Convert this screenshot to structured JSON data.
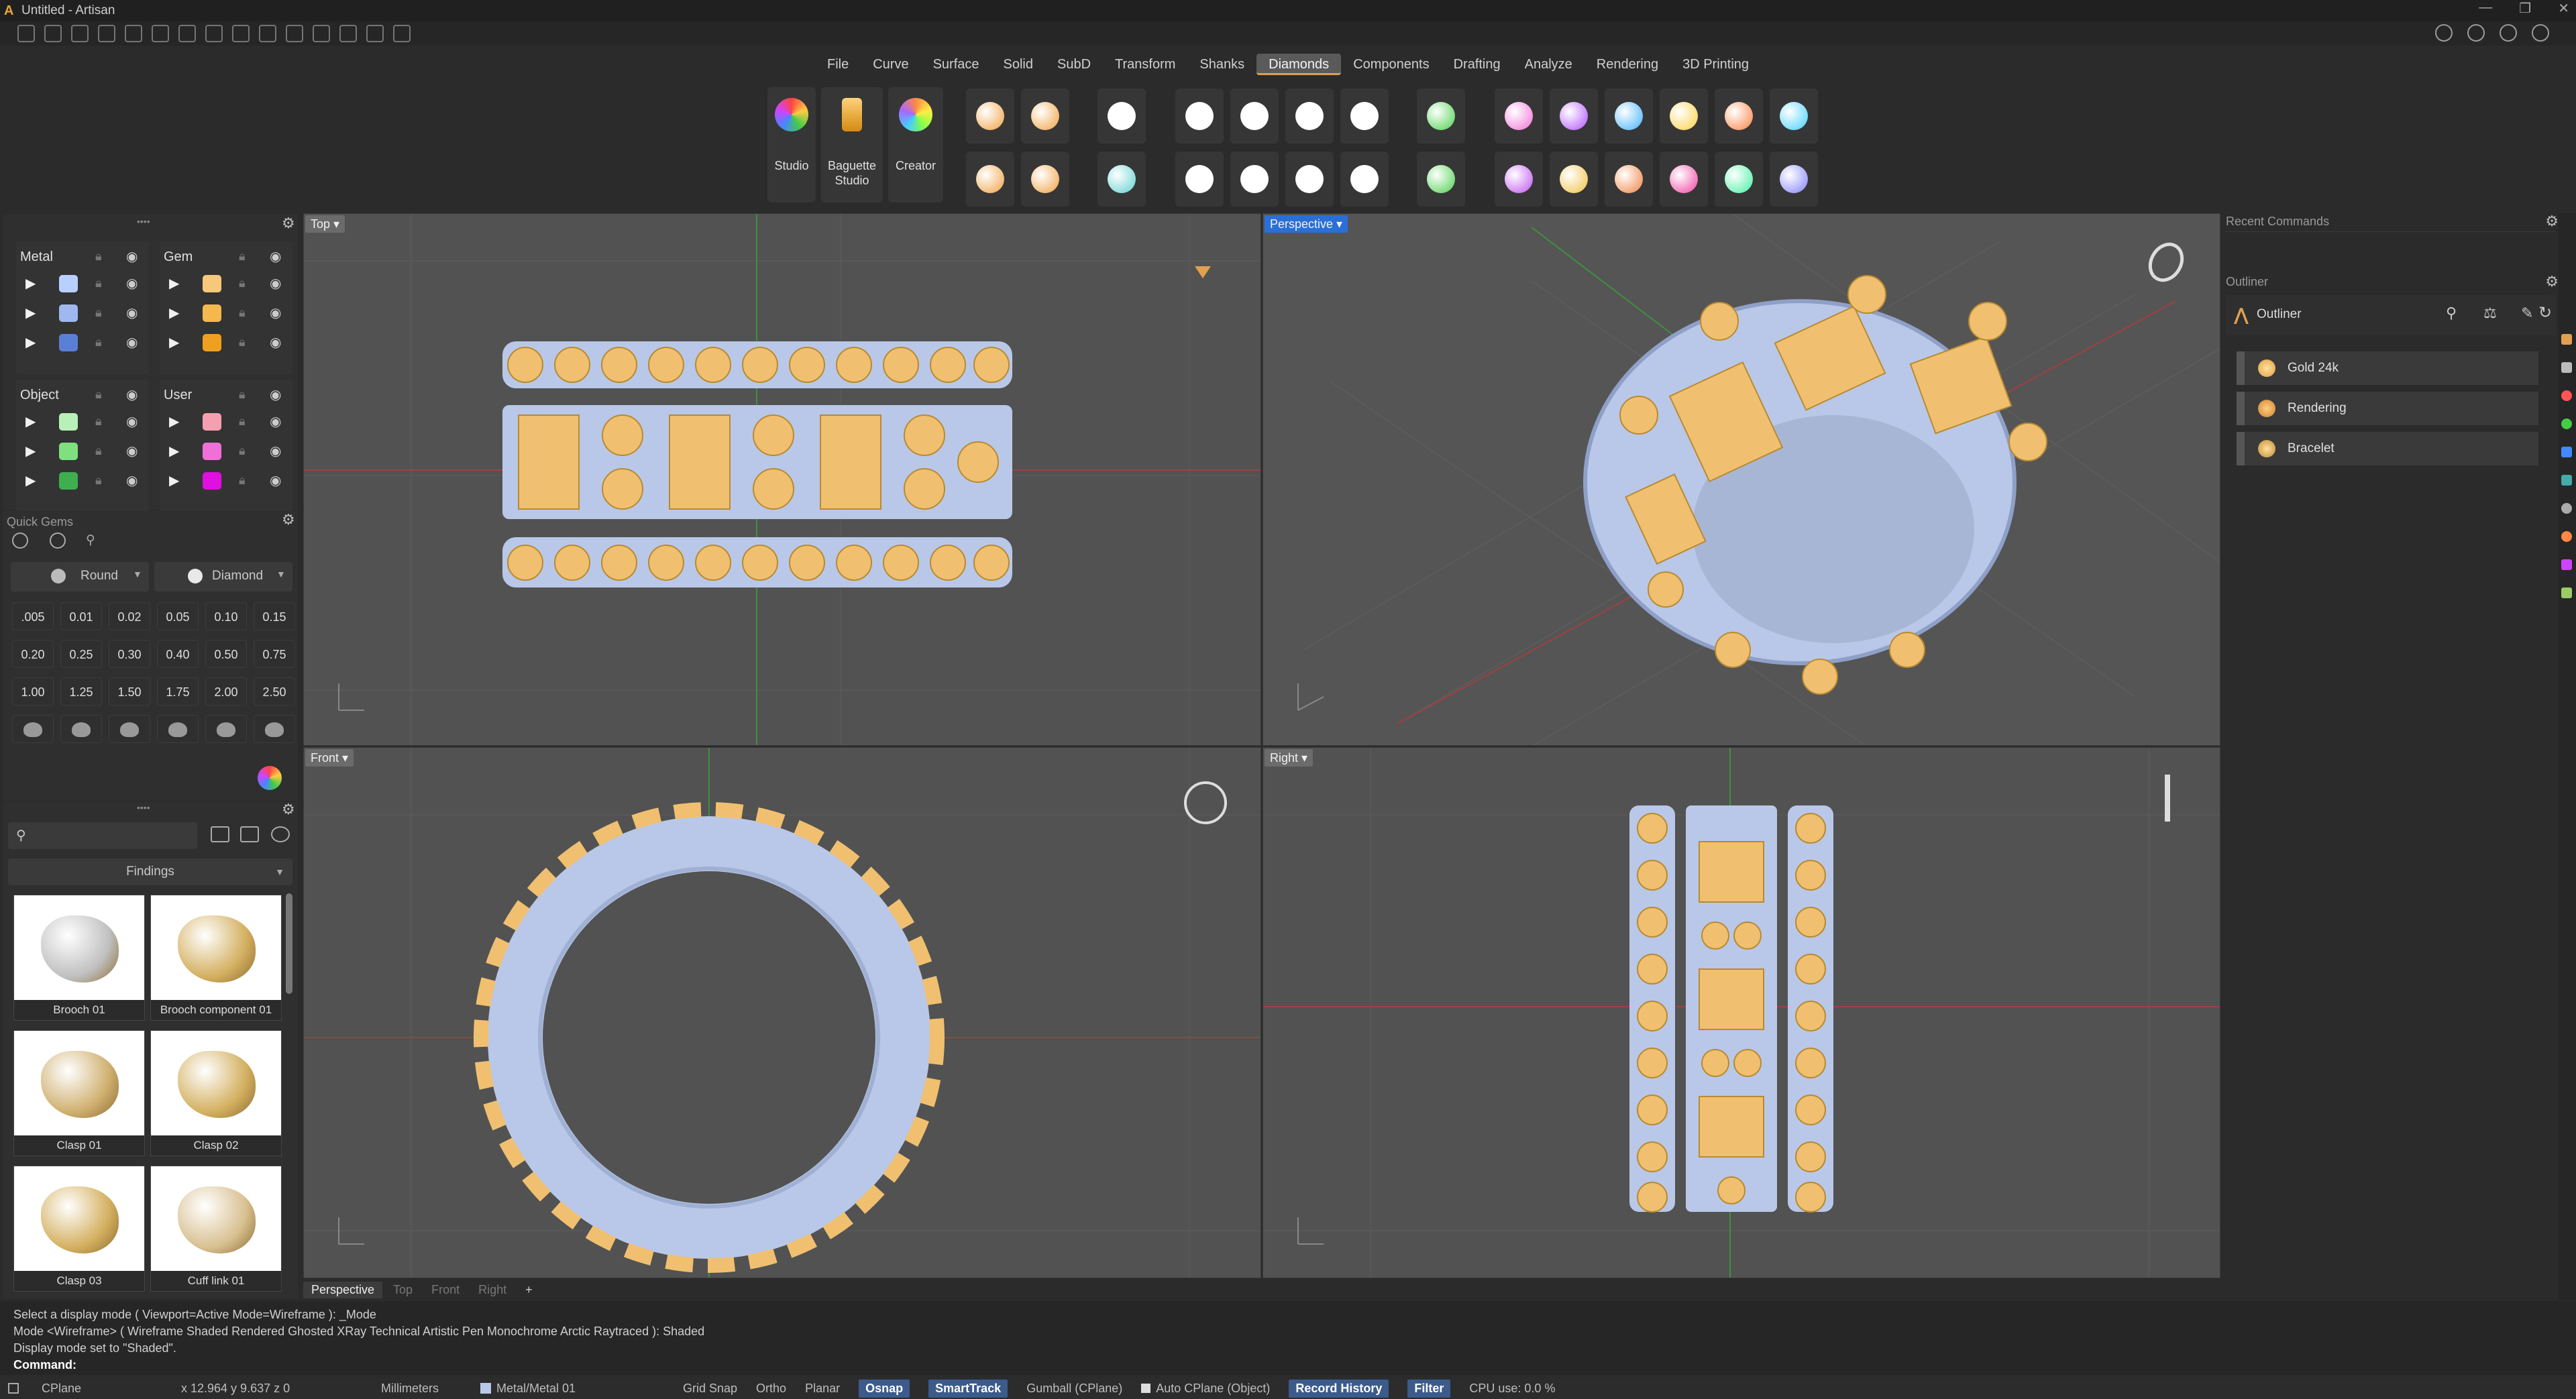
{
  "window": {
    "title": "Untitled - Artisan"
  },
  "menu": [
    "File",
    "Curve",
    "Surface",
    "Solid",
    "SubD",
    "Transform",
    "Shanks",
    "Diamonds",
    "Components",
    "Drafting",
    "Analyze",
    "Rendering",
    "3D Printing"
  ],
  "menu_active": "Diamonds",
  "ribbon": {
    "studio": "Studio",
    "baguette_line1": "Baguette",
    "baguette_line2": "Studio",
    "creator": "Creator"
  },
  "layers": {
    "metal": "Metal",
    "gem": "Gem",
    "object": "Object",
    "user": "User",
    "colors": {
      "metal": [
        "#b8d0ff",
        "#9fb8f0",
        "#5a7fd6"
      ],
      "gem": [
        "#f7c87a",
        "#f5b84e",
        "#f0a020"
      ],
      "object": [
        "#b8f0b8",
        "#7ee07e",
        "#3fae4f"
      ],
      "user": [
        "#f5a0b0",
        "#f070d8",
        "#e010e0"
      ]
    }
  },
  "quick_gems": {
    "title": "Quick Gems",
    "shape": "Round",
    "material": "Diamond",
    "sizes": [
      ".005",
      "0.01",
      "0.02",
      "0.05",
      "0.10",
      "0.15",
      "0.20",
      "0.25",
      "0.30",
      "0.40",
      "0.50",
      "0.75",
      "1.00",
      "1.25",
      "1.50",
      "1.75",
      "2.00",
      "2.50"
    ]
  },
  "library": {
    "category": "Findings",
    "items": [
      "Brooch 01",
      "Brooch component 01",
      "Clasp 01",
      "Clasp 02",
      "Clasp 03",
      "Cuff link 01"
    ]
  },
  "viewports": {
    "top": "Top",
    "perspective": "Perspective",
    "front": "Front",
    "right": "Right",
    "tabs": [
      "Perspective",
      "Top",
      "Front",
      "Right"
    ],
    "add_tab": "+"
  },
  "right_panel": {
    "recent_commands": "Recent Commands",
    "outliner_section": "Outliner",
    "outliner_title": "Outliner",
    "rows": [
      "Gold 24k",
      "Rendering",
      "Bracelet"
    ]
  },
  "command": {
    "lines": [
      "Select a display mode ( Viewport=Active  Mode=Wireframe ): _Mode",
      "Mode <Wireframe> ( Wireframe  Shaded  Rendered  Ghosted  XRay  Technical  Artistic  Pen  Monochrome  Arctic  Raytraced ): Shaded",
      "Display mode set to \"Shaded\"."
    ],
    "prompt": "Command:"
  },
  "status": {
    "cplane": "CPlane",
    "coords": "x 12.964  y 9.637  z 0",
    "units": "Millimeters",
    "layer": "Metal/Metal 01",
    "grid_snap": "Grid Snap",
    "ortho": "Ortho",
    "planar": "Planar",
    "osnap": "Osnap",
    "smarttrack": "SmartTrack",
    "gumball": "Gumball (CPlane)",
    "autocplane": "Auto CPlane (Object)",
    "record_history": "Record History",
    "filter": "Filter",
    "cpu": "CPU use: 0.0 %"
  },
  "accent": "#e0a050",
  "metal_color": "#b9c8e8",
  "gold_color": "#f0c070"
}
